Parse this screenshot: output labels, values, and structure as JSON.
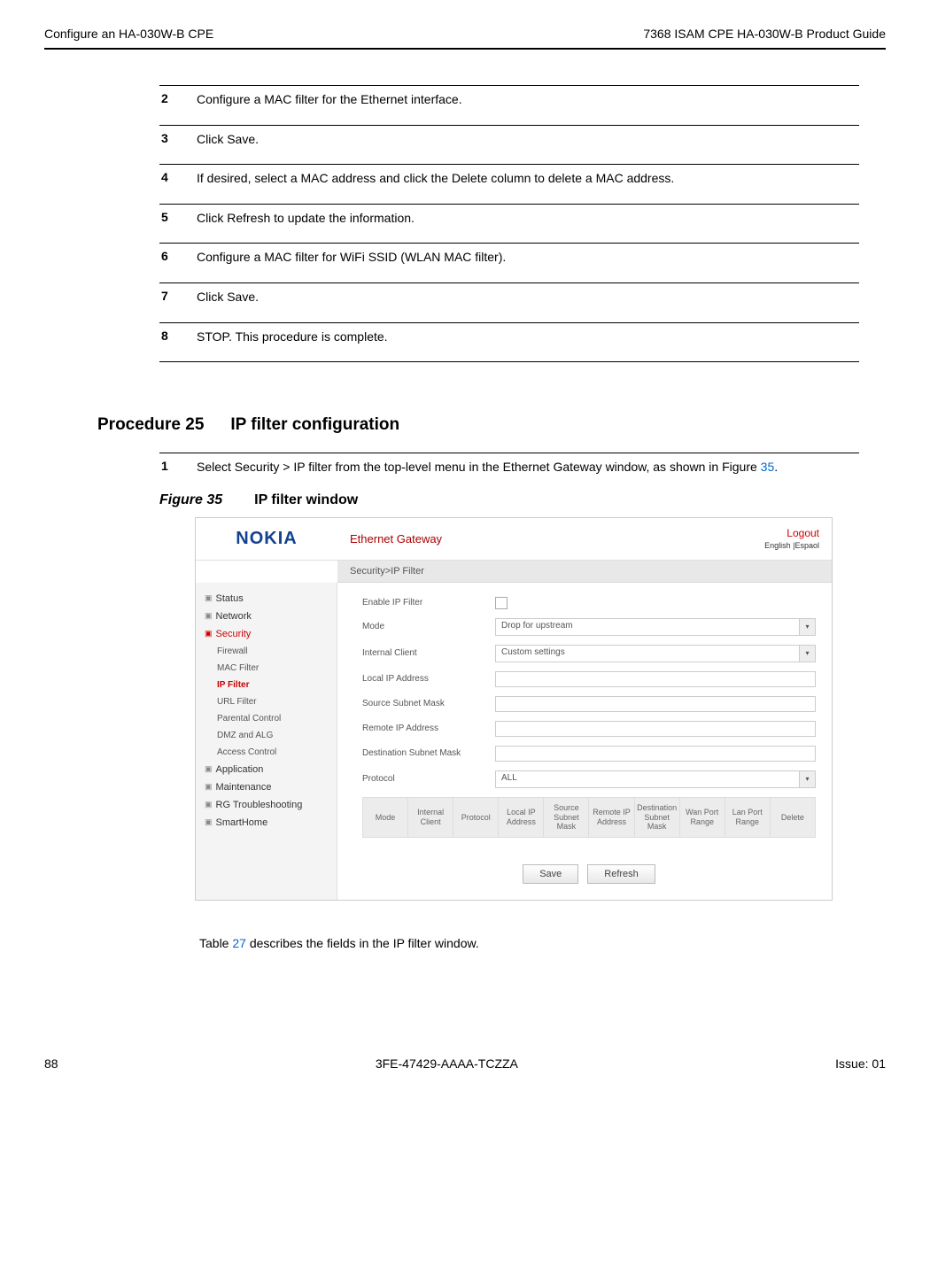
{
  "header": {
    "left": "Configure an HA-030W-B CPE",
    "right": "7368 ISAM CPE HA-030W-B Product Guide"
  },
  "steps": [
    {
      "num": "2",
      "text": "Configure a MAC filter for the Ethernet interface."
    },
    {
      "num": "3",
      "text": "Click Save."
    },
    {
      "num": "4",
      "text": "If desired, select a MAC address and click the Delete column to delete a MAC address."
    },
    {
      "num": "5",
      "text": "Click Refresh to update the information."
    },
    {
      "num": "6",
      "text": "Configure a MAC filter for WiFi SSID (WLAN MAC filter)."
    },
    {
      "num": "7",
      "text": "Click Save."
    },
    {
      "num": "8",
      "text": "STOP. This procedure is complete."
    }
  ],
  "procedure": {
    "label": "Procedure 25",
    "title": "IP filter configuration"
  },
  "step1": {
    "num": "1",
    "text_prefix": "Select Security > IP filter from the top-level menu in the Ethernet Gateway window, as shown in Figure ",
    "link": "35",
    "text_suffix": "."
  },
  "figure": {
    "label": "Figure 35",
    "title": "IP filter window"
  },
  "screenshot": {
    "logo": "NOKIA",
    "gateway_title": "Ethernet Gateway",
    "logout": "Logout",
    "langs": "English |Espaol",
    "breadcrumb": "Security>IP Filter",
    "sidebar": {
      "status": "Status",
      "network": "Network",
      "security": "Security",
      "sub": {
        "firewall": "Firewall",
        "macfilter": "MAC Filter",
        "ipfilter": "IP Filter",
        "urlfilter": "URL Filter",
        "parental": "Parental Control",
        "dmz": "DMZ and ALG",
        "access": "Access Control"
      },
      "application": "Application",
      "maintenance": "Maintenance",
      "rgtrouble": "RG Troubleshooting",
      "smarthome": "SmartHome"
    },
    "form": {
      "enable_label": "Enable IP Filter",
      "mode_label": "Mode",
      "mode_value": "Drop for upstream",
      "client_label": "Internal Client",
      "client_value": "Custom settings",
      "localip_label": "Local IP Address",
      "srcmask_label": "Source Subnet Mask",
      "remoteip_label": "Remote IP Address",
      "dstmask_label": "Destination Subnet Mask",
      "protocol_label": "Protocol",
      "protocol_value": "ALL"
    },
    "table_headers": [
      "Mode",
      "Internal Client",
      "Protocol",
      "Local IP Address",
      "Source Subnet Mask",
      "Remote IP Address",
      "Destination Subnet Mask",
      "Wan Port Range",
      "Lan Port Range",
      "Delete"
    ],
    "buttons": {
      "save": "Save",
      "refresh": "Refresh"
    }
  },
  "after_figure": {
    "prefix": "Table ",
    "link": "27",
    "suffix": " describes the fields in the IP filter window."
  },
  "footer": {
    "left": "88",
    "center": "3FE-47429-AAAA-TCZZA",
    "right": "Issue: 01"
  }
}
